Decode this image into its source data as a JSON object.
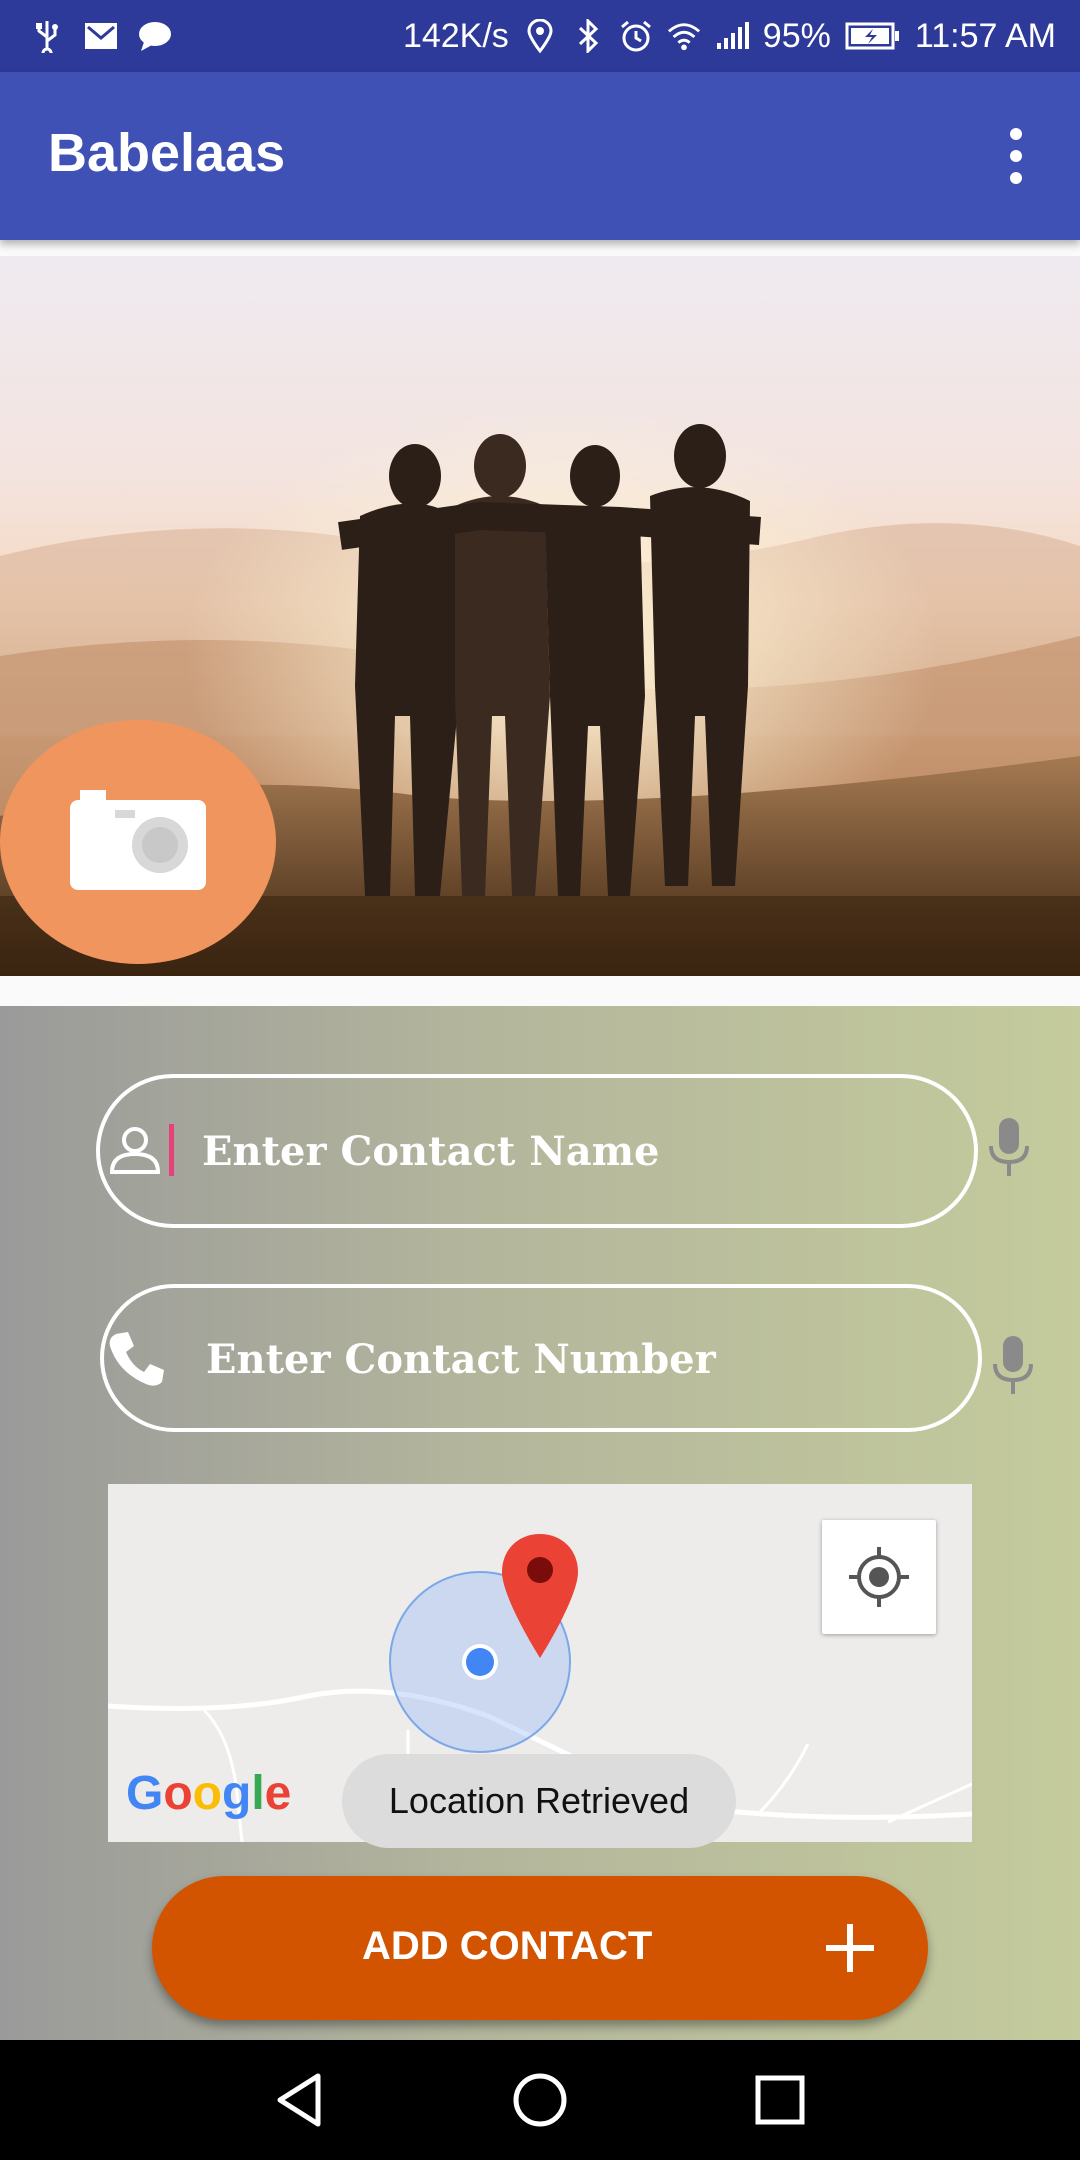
{
  "status_bar": {
    "net_speed": "142K/s",
    "battery": "95%",
    "time": "11:57 AM"
  },
  "app_bar": {
    "title": "Babelaas",
    "menu_icon": "more-vert-icon"
  },
  "hero": {
    "camera_icon": "camera-icon"
  },
  "form": {
    "name_placeholder": "Enter Contact Name",
    "number_placeholder": "Enter Contact Number",
    "name_icon": "person-icon",
    "number_icon": "phone-icon",
    "mic_icon": "mic-icon"
  },
  "map": {
    "google_letters": [
      "G",
      "o",
      "o",
      "g",
      "l",
      "e"
    ],
    "google_colors": [
      "#4285F4",
      "#EA4335",
      "#FBBC05",
      "#4285F4",
      "#34A853",
      "#EA4335"
    ],
    "my_location_icon": "my-location-icon",
    "marker_icon": "map-pin-icon"
  },
  "toast": {
    "text": "Location Retrieved"
  },
  "add_button": {
    "label": "ADD CONTACT",
    "icon": "plus-icon",
    "color": "#d35400"
  },
  "colors": {
    "primary": "#3f51b5",
    "status_bar": "#2e3a9a",
    "camera_fab": "#f1955e"
  }
}
